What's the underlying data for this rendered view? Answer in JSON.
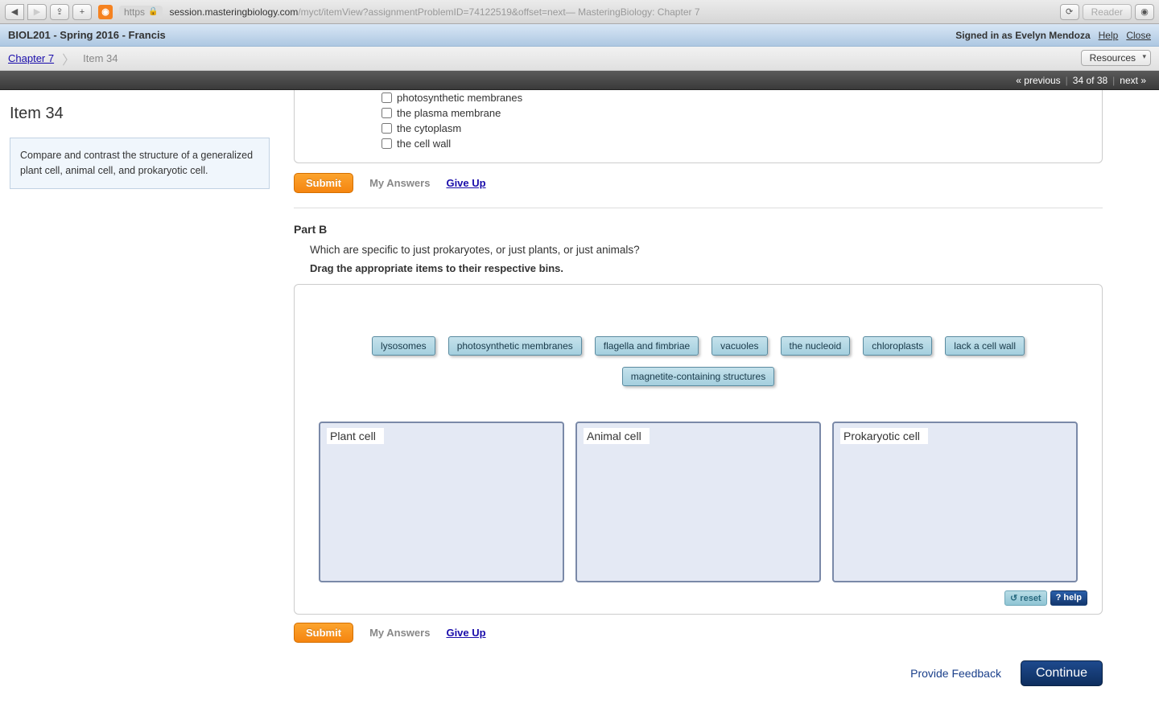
{
  "browser": {
    "scheme": "https",
    "domain": "session.masteringbiology.com",
    "path": "/myct/itemView?assignmentProblemID=74122519&offset=next",
    "tab_title": " — MasteringBiology: Chapter 7",
    "reader_label": "Reader"
  },
  "header": {
    "course_title": "BIOL201 - Spring 2016 - Francis",
    "signed_in_prefix": "Signed in as ",
    "user_name": "Evelyn Mendoza",
    "help_label": "Help",
    "close_label": "Close"
  },
  "breadcrumb": {
    "chapter_link": "Chapter 7",
    "item_label": "Item 34",
    "resources_label": "Resources"
  },
  "progress": {
    "prev_label": "« previous",
    "position": "34 of 38",
    "next_label": "next »"
  },
  "sidebar": {
    "title": "Item 34",
    "description": "Compare and contrast the structure of a generalized plant cell, animal cell, and prokaryotic cell."
  },
  "partA": {
    "options": [
      "photosynthetic membranes",
      "the plasma membrane",
      "the cytoplasm",
      "the cell wall"
    ],
    "submit_label": "Submit",
    "my_answers_label": "My Answers",
    "give_up_label": "Give Up"
  },
  "partB": {
    "title": "Part B",
    "question": "Which are specific to just prokaryotes, or just plants, or just animals?",
    "instruction": "Drag the appropriate items to their respective bins.",
    "chips": [
      "lysosomes",
      "photosynthetic membranes",
      "flagella and fimbriae",
      "vacuoles",
      "the nucleoid",
      "chloroplasts",
      "lack a cell wall",
      "magnetite-containing structures"
    ],
    "bins": [
      "Plant cell",
      "Animal cell",
      "Prokaryotic cell"
    ],
    "reset_label": "reset",
    "help_label": "help",
    "submit_label": "Submit",
    "my_answers_label": "My Answers",
    "give_up_label": "Give Up"
  },
  "footer": {
    "feedback_label": "Provide Feedback",
    "continue_label": "Continue"
  }
}
